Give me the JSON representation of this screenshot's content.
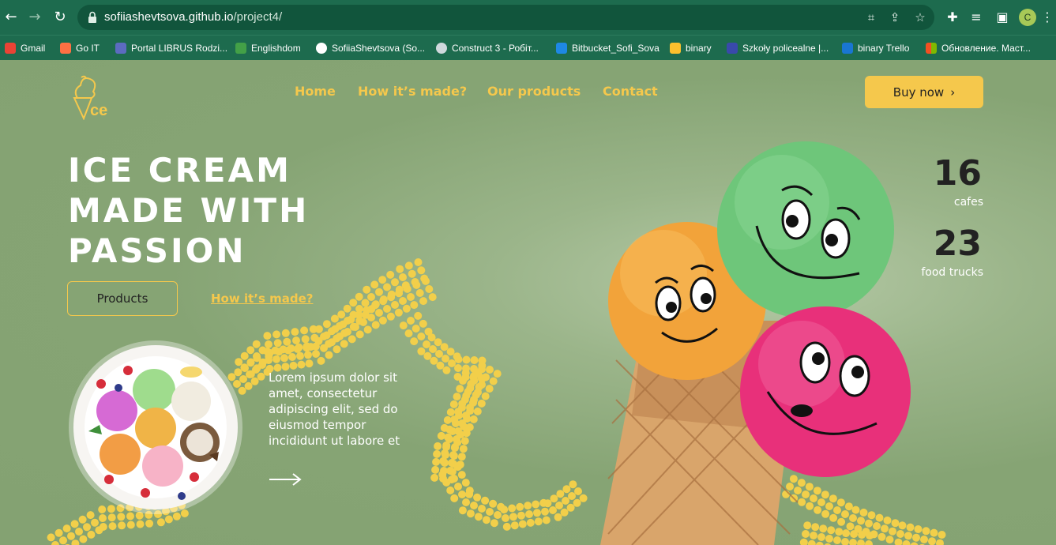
{
  "browser": {
    "url_host": "sofiiashevtsova.github.io",
    "url_path": "/project4/",
    "profile_initial": "C",
    "bookmarks": [
      {
        "label": "Gmail",
        "color": "#ea4335"
      },
      {
        "label": "Go IT",
        "color": "#ff7043"
      },
      {
        "label": "Portal LIBRUS Rodzi...",
        "color": "#5c6bc0"
      },
      {
        "label": "Englishdom",
        "color": "#43a047"
      },
      {
        "label": "SofiiaShevtsova (So...",
        "color": "#ffffff"
      },
      {
        "label": "Construct 3 - Робіт...",
        "color": "#cfd8dc"
      },
      {
        "label": "Bitbucket_Sofi_Sova",
        "color": "#1e88e5"
      },
      {
        "label": "binary",
        "color": "#fbc02d"
      },
      {
        "label": "Szkoły policealne |...",
        "color": "#3949ab"
      },
      {
        "label": "binary Trello",
        "color": "#1976d2"
      },
      {
        "label": "Обновление. Маст...",
        "color": "#f25022"
      }
    ]
  },
  "site": {
    "nav": [
      "Home",
      "How it’s made?",
      "Our products",
      "Contact"
    ],
    "buy_label": "Buy now",
    "hero_lines": [
      "ICE CREAM",
      "MADE WITH",
      "PASSION"
    ],
    "products_label": "Products",
    "how_label": "How it’s made?",
    "lorem": "Lorem ipsum dolor sit amet, consectetur adipiscing elit, sed do eiusmod tempor incididunt ut labore et",
    "stats": [
      {
        "value": "16",
        "label": "cafes"
      },
      {
        "value": "23",
        "label": "food trucks"
      }
    ],
    "colors": {
      "accent": "#f5c84c",
      "background": "#8aa87a"
    }
  }
}
